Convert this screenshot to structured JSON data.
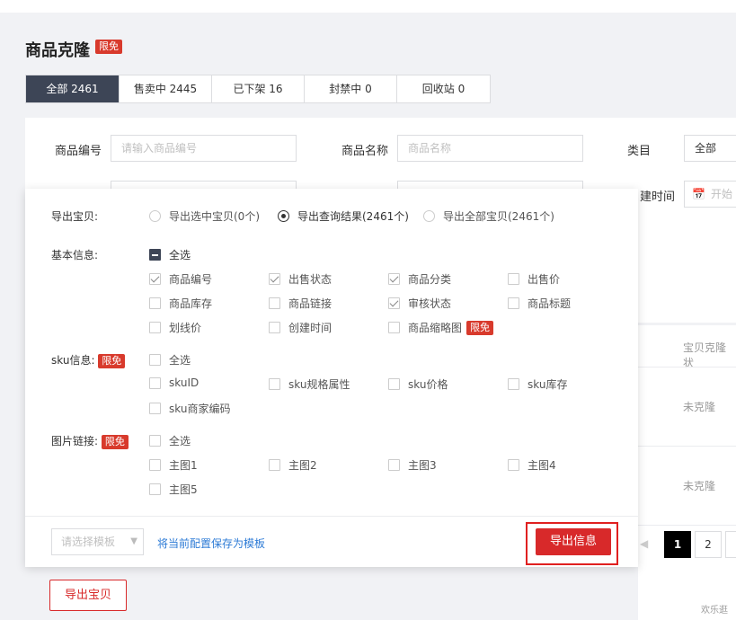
{
  "page": {
    "title": "商品克隆",
    "title_badge": "限免",
    "tabs": [
      {
        "label": "全部 2461",
        "active": true
      },
      {
        "label": "售卖中 2445",
        "active": false
      },
      {
        "label": "已下架 16",
        "active": false
      },
      {
        "label": "封禁中 0",
        "active": false
      },
      {
        "label": "回收站 0",
        "active": false
      }
    ]
  },
  "filters": {
    "code_label": "商品编号",
    "code_placeholder": "请输入商品编号",
    "name_label": "商品名称",
    "name_placeholder": "商品名称",
    "category_label": "类目",
    "category_value": "全部",
    "created_label": "建时间",
    "created_placeholder": "开始"
  },
  "table": {
    "col_header": "宝贝克隆状",
    "rows": [
      "未克隆",
      "未克隆"
    ]
  },
  "pagination": {
    "pages": [
      "1",
      "2"
    ],
    "current": "1",
    "prev_icon": "chevron-left-icon"
  },
  "export_panel": {
    "export_label": "导出宝贝:",
    "export_options": [
      {
        "label": "导出选中宝贝(0个)",
        "selected": false
      },
      {
        "label": "导出查询结果(2461个)",
        "selected": true
      },
      {
        "label": "导出全部宝贝(2461个)",
        "selected": false
      }
    ],
    "basic_label": "基本信息:",
    "basic_select_all": "全选",
    "basic_fields": [
      {
        "label": "商品编号",
        "checked": true
      },
      {
        "label": "出售状态",
        "checked": true
      },
      {
        "label": "商品分类",
        "checked": true
      },
      {
        "label": "出售价",
        "checked": false
      },
      {
        "label": "商品库存",
        "checked": false
      },
      {
        "label": "商品链接",
        "checked": false
      },
      {
        "label": "审核状态",
        "checked": true
      },
      {
        "label": "商品标题",
        "checked": false
      },
      {
        "label": "划线价",
        "checked": false
      },
      {
        "label": "创建时间",
        "checked": false
      },
      {
        "label": "商品缩略图",
        "checked": false,
        "badge": "限免"
      }
    ],
    "sku_label": "sku信息:",
    "sku_badge": "限免",
    "sku_select_all": "全选",
    "sku_fields": [
      "skuID",
      "sku规格属性",
      "sku价格",
      "sku库存",
      "sku商家编码"
    ],
    "img_label": "图片链接:",
    "img_badge": "限免",
    "img_select_all": "全选",
    "img_fields": [
      "主图1",
      "主图2",
      "主图3",
      "主图4",
      "主图5"
    ],
    "template_placeholder": "请选择模板",
    "save_template_link": "将当前配置保存为模板",
    "export_button": "导出信息"
  },
  "bottom": {
    "export_items_button": "导出宝贝",
    "watermark": "欢乐逛"
  },
  "colors": {
    "accent_red": "#d8292a",
    "dark_tab": "#3d4556",
    "link_blue": "#2d7bd6"
  }
}
